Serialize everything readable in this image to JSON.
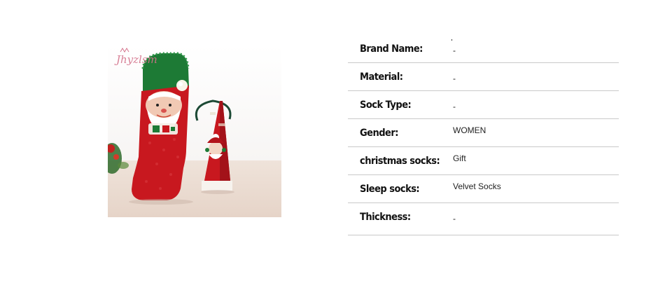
{
  "product": {
    "image_alt": "Christmas fuzzy socks with Santa face and gift box",
    "watermark": "Jhyzlsm"
  },
  "specs": [
    {
      "label": "Brand Name:",
      "value": "-"
    },
    {
      "label": "Material:",
      "value": "-"
    },
    {
      "label": "Sock Type:",
      "value": "-"
    },
    {
      "label": "Gender:",
      "value": "WOMEN"
    },
    {
      "label": "christmas socks:",
      "value": "Gift"
    },
    {
      "label": "Sleep socks:",
      "value": "Velvet Socks"
    },
    {
      "label": "Thickness:",
      "value": "-"
    }
  ],
  "colors": {
    "sock_red": "#c8181f",
    "sock_green": "#1d7a35",
    "row_border": "#c9c9c9"
  }
}
